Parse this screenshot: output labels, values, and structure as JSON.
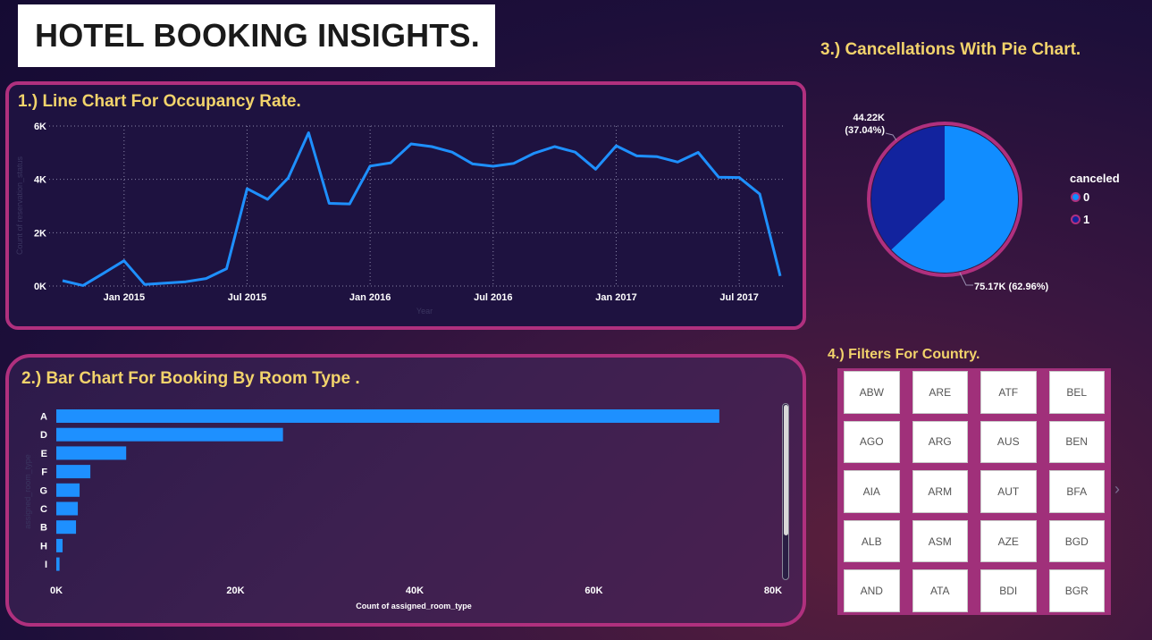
{
  "title": "HOTEL BOOKING INSIGHTS.",
  "sections": {
    "line": "1.) Line Chart For Occupancy Rate.",
    "bar": "2.) Bar Chart For Booking By Room Type .",
    "pie": "3.) Cancellations With Pie Chart.",
    "filters": "4.) Filters For Country."
  },
  "chart_data": [
    {
      "type": "line",
      "title": "1.) Line Chart For Occupancy Rate.",
      "xlabel": "Year",
      "ylabel": "Count of reservation_status",
      "ylim": [
        0,
        6000
      ],
      "yticks": [
        "0K",
        "2K",
        "4K",
        "6K"
      ],
      "xticks": [
        "Jan 2015",
        "Jul 2015",
        "Jan 2016",
        "Jul 2016",
        "Jan 2017",
        "Jul 2017"
      ],
      "grid": true,
      "color": "#1e90ff",
      "x": [
        "2014-10",
        "2014-11",
        "2014-12",
        "2015-01",
        "2015-02",
        "2015-03",
        "2015-04",
        "2015-05",
        "2015-06",
        "2015-07",
        "2015-08",
        "2015-09",
        "2015-10",
        "2015-11",
        "2015-12",
        "2016-01",
        "2016-02",
        "2016-03",
        "2016-04",
        "2016-05",
        "2016-06",
        "2016-07",
        "2016-08",
        "2016-09",
        "2016-10",
        "2016-11",
        "2016-12",
        "2017-01",
        "2017-02",
        "2017-03",
        "2017-04",
        "2017-05",
        "2017-06",
        "2017-07",
        "2017-08",
        "2017-09"
      ],
      "values": [
        200,
        20,
        480,
        950,
        60,
        110,
        160,
        280,
        650,
        3650,
        3250,
        4050,
        5750,
        3100,
        3080,
        4500,
        4620,
        5330,
        5230,
        5020,
        4580,
        4490,
        4600,
        4980,
        5230,
        5020,
        4380,
        5260,
        4880,
        4850,
        4650,
        5010,
        4080,
        4070,
        3450,
        380
      ]
    },
    {
      "type": "bar",
      "title": "2.) Bar Chart For Booking By Room Type .",
      "xlabel": "Count of assigned_room_type",
      "ylabel": "assigned_room_type",
      "xlim": [
        0,
        80000
      ],
      "xticks": [
        "0K",
        "20K",
        "40K",
        "60K",
        "80K"
      ],
      "color": "#1e90ff",
      "categories": [
        "A",
        "D",
        "E",
        "F",
        "G",
        "C",
        "B",
        "H",
        "I"
      ],
      "values": [
        74000,
        25300,
        7800,
        3800,
        2600,
        2400,
        2200,
        700,
        360
      ]
    },
    {
      "type": "pie",
      "title": "3.) Cancellations With Pie Chart.",
      "legend_title": "canceled",
      "legend_position": "right",
      "slices": [
        {
          "label": "0",
          "value": 75170,
          "display": "75.17K (62.96%)",
          "color": "#118dff"
        },
        {
          "label": "1",
          "value": 44220,
          "display": "44.22K\n(37.04%)",
          "color": "#12239e"
        }
      ]
    }
  ],
  "pie_labels": {
    "slice1_line1": "44.22K",
    "slice1_line2": "(37.04%)",
    "slice0": "75.17K (62.96%)"
  },
  "legend": {
    "title": "canceled",
    "items": [
      {
        "label": "0",
        "color": "#118dff"
      },
      {
        "label": "1",
        "color": "#12239e"
      }
    ]
  },
  "filters": {
    "countries": [
      "ABW",
      "ARE",
      "ATF",
      "BEL",
      "AGO",
      "ARG",
      "AUS",
      "BEN",
      "AIA",
      "ARM",
      "AUT",
      "BFA",
      "ALB",
      "ASM",
      "AZE",
      "BGD",
      "AND",
      "ATA",
      "BDI",
      "BGR"
    ],
    "next_icon": "chevron-right-icon"
  },
  "colors": {
    "accent": "#f2d36b",
    "border": "#b0307e",
    "series": "#1e90ff"
  }
}
